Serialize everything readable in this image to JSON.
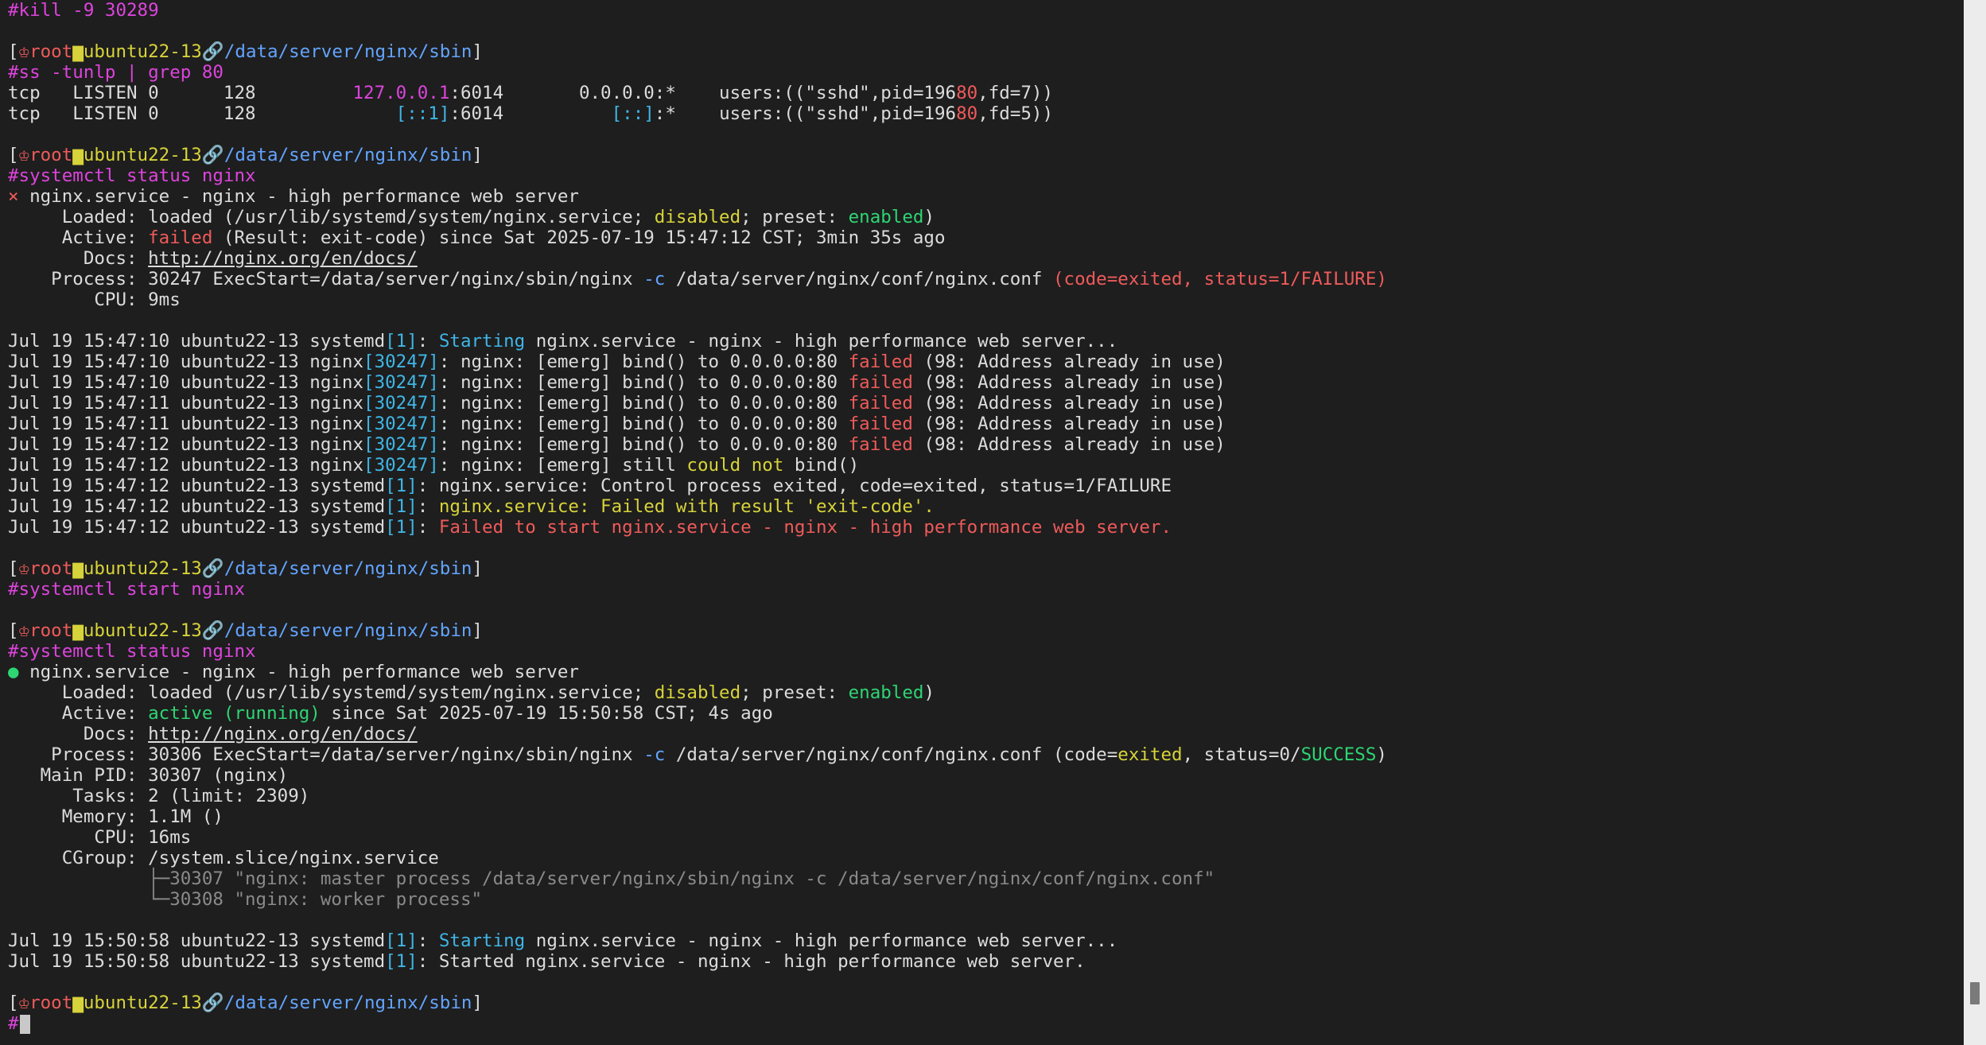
{
  "terminal": {
    "lines": [
      {
        "segs": [
          {
            "t": "#kill -9 30289",
            "c": "magenta"
          }
        ]
      },
      {
        "segs": []
      },
      {
        "segs": [
          {
            "t": "[",
            "c": "dim"
          },
          {
            "t": "♔",
            "c": "red"
          },
          {
            "t": "root",
            "c": "red"
          },
          {
            "t": "▆",
            "c": "yellow"
          },
          {
            "t": "ubuntu22-13",
            "c": "yellow"
          },
          {
            "t": "🔗",
            "c": "magenta"
          },
          {
            "t": "/data/server/nginx/sbin",
            "c": "blue"
          },
          {
            "t": "]",
            "c": "dim"
          }
        ]
      },
      {
        "segs": [
          {
            "t": "#ss -tunlp | grep 80",
            "c": "magenta"
          }
        ]
      },
      {
        "segs": [
          {
            "t": "tcp   LISTEN 0      128         ",
            "c": "dim"
          },
          {
            "t": "127.0.0.1",
            "c": "magenta"
          },
          {
            "t": ":6014       0.0.0.0:*    users:((\"sshd\",pid=196",
            "c": "dim"
          },
          {
            "t": "80",
            "c": "red"
          },
          {
            "t": ",fd=7))",
            "c": "dim"
          }
        ]
      },
      {
        "segs": [
          {
            "t": "tcp   LISTEN 0      128             ",
            "c": "dim"
          },
          {
            "t": "[::1]",
            "c": "cyan"
          },
          {
            "t": ":6014          ",
            "c": "dim"
          },
          {
            "t": "[::]",
            "c": "cyan"
          },
          {
            "t": ":*    users:((\"sshd\",pid=196",
            "c": "dim"
          },
          {
            "t": "80",
            "c": "red"
          },
          {
            "t": ",fd=5))",
            "c": "dim"
          }
        ]
      },
      {
        "segs": []
      },
      {
        "segs": [
          {
            "t": "[",
            "c": "dim"
          },
          {
            "t": "♔",
            "c": "red"
          },
          {
            "t": "root",
            "c": "red"
          },
          {
            "t": "▆",
            "c": "yellow"
          },
          {
            "t": "ubuntu22-13",
            "c": "yellow"
          },
          {
            "t": "🔗",
            "c": "magenta"
          },
          {
            "t": "/data/server/nginx/sbin",
            "c": "blue"
          },
          {
            "t": "]",
            "c": "dim"
          }
        ]
      },
      {
        "segs": [
          {
            "t": "#systemctl status nginx",
            "c": "magenta"
          }
        ]
      },
      {
        "segs": [
          {
            "t": "× ",
            "c": "red"
          },
          {
            "t": "nginx.service - nginx - high performance web server",
            "c": "dim"
          }
        ]
      },
      {
        "segs": [
          {
            "t": "     Loaded: loaded (/usr/lib/systemd/system/nginx.service; ",
            "c": "dim"
          },
          {
            "t": "disabled",
            "c": "yellow"
          },
          {
            "t": "; preset: ",
            "c": "dim"
          },
          {
            "t": "enabled",
            "c": "green"
          },
          {
            "t": ")",
            "c": "dim"
          }
        ]
      },
      {
        "segs": [
          {
            "t": "     Active: ",
            "c": "dim"
          },
          {
            "t": "failed",
            "c": "red"
          },
          {
            "t": " (Result: exit-code) since Sat 2025-07-19 15:47:12 CST; 3min 35s ago",
            "c": "dim"
          }
        ]
      },
      {
        "segs": [
          {
            "t": "       Docs: ",
            "c": "dim"
          },
          {
            "t": "http://nginx.org/en/docs/",
            "c": "dim",
            "u": true
          }
        ]
      },
      {
        "segs": [
          {
            "t": "    Process: 30247 ExecStart=/data/server/nginx/sbin/nginx ",
            "c": "dim"
          },
          {
            "t": "-c",
            "c": "blue"
          },
          {
            "t": " /data/server/nginx/conf/nginx.conf ",
            "c": "dim"
          },
          {
            "t": "(code=exited, status=1/FAILURE)",
            "c": "red"
          }
        ]
      },
      {
        "segs": [
          {
            "t": "        CPU: 9ms",
            "c": "dim"
          }
        ]
      },
      {
        "segs": []
      },
      {
        "segs": [
          {
            "t": "Jul 19 15:47:10 ubuntu22-13 systemd",
            "c": "dim"
          },
          {
            "t": "[1]",
            "c": "cyan"
          },
          {
            "t": ": ",
            "c": "dim"
          },
          {
            "t": "Starting",
            "c": "cyan"
          },
          {
            "t": " nginx.service - nginx - high performance web server...",
            "c": "dim"
          }
        ]
      },
      {
        "segs": [
          {
            "t": "Jul 19 15:47:10 ubuntu22-13 nginx",
            "c": "dim"
          },
          {
            "t": "[30247]",
            "c": "cyan"
          },
          {
            "t": ": nginx: [emerg] bind() to 0.0.0.0:80 ",
            "c": "dim"
          },
          {
            "t": "failed",
            "c": "red"
          },
          {
            "t": " (98: Address already in use)",
            "c": "dim"
          }
        ]
      },
      {
        "segs": [
          {
            "t": "Jul 19 15:47:10 ubuntu22-13 nginx",
            "c": "dim"
          },
          {
            "t": "[30247]",
            "c": "cyan"
          },
          {
            "t": ": nginx: [emerg] bind() to 0.0.0.0:80 ",
            "c": "dim"
          },
          {
            "t": "failed",
            "c": "red"
          },
          {
            "t": " (98: Address already in use)",
            "c": "dim"
          }
        ]
      },
      {
        "segs": [
          {
            "t": "Jul 19 15:47:11 ubuntu22-13 nginx",
            "c": "dim"
          },
          {
            "t": "[30247]",
            "c": "cyan"
          },
          {
            "t": ": nginx: [emerg] bind() to 0.0.0.0:80 ",
            "c": "dim"
          },
          {
            "t": "failed",
            "c": "red"
          },
          {
            "t": " (98: Address already in use)",
            "c": "dim"
          }
        ]
      },
      {
        "segs": [
          {
            "t": "Jul 19 15:47:11 ubuntu22-13 nginx",
            "c": "dim"
          },
          {
            "t": "[30247]",
            "c": "cyan"
          },
          {
            "t": ": nginx: [emerg] bind() to 0.0.0.0:80 ",
            "c": "dim"
          },
          {
            "t": "failed",
            "c": "red"
          },
          {
            "t": " (98: Address already in use)",
            "c": "dim"
          }
        ]
      },
      {
        "segs": [
          {
            "t": "Jul 19 15:47:12 ubuntu22-13 nginx",
            "c": "dim"
          },
          {
            "t": "[30247]",
            "c": "cyan"
          },
          {
            "t": ": nginx: [emerg] bind() to 0.0.0.0:80 ",
            "c": "dim"
          },
          {
            "t": "failed",
            "c": "red"
          },
          {
            "t": " (98: Address already in use)",
            "c": "dim"
          }
        ]
      },
      {
        "segs": [
          {
            "t": "Jul 19 15:47:12 ubuntu22-13 nginx",
            "c": "dim"
          },
          {
            "t": "[30247]",
            "c": "cyan"
          },
          {
            "t": ": nginx: [emerg] still ",
            "c": "dim"
          },
          {
            "t": "could not",
            "c": "yellow"
          },
          {
            "t": " bind()",
            "c": "dim"
          }
        ]
      },
      {
        "segs": [
          {
            "t": "Jul 19 15:47:12 ubuntu22-13 systemd",
            "c": "dim"
          },
          {
            "t": "[1]",
            "c": "cyan"
          },
          {
            "t": ": nginx.service: Control process exited, code=exited, status=1/FAILURE",
            "c": "dim"
          }
        ]
      },
      {
        "segs": [
          {
            "t": "Jul 19 15:47:12 ubuntu22-13 systemd",
            "c": "dim"
          },
          {
            "t": "[1]",
            "c": "cyan"
          },
          {
            "t": ": ",
            "c": "dim"
          },
          {
            "t": "nginx.service: Failed with result 'exit-code'.",
            "c": "yellow"
          }
        ]
      },
      {
        "segs": [
          {
            "t": "Jul 19 15:47:12 ubuntu22-13 systemd",
            "c": "dim"
          },
          {
            "t": "[1]",
            "c": "cyan"
          },
          {
            "t": ": ",
            "c": "dim"
          },
          {
            "t": "Failed to start nginx.service - nginx - high performance web server.",
            "c": "red"
          }
        ]
      },
      {
        "segs": []
      },
      {
        "segs": [
          {
            "t": "[",
            "c": "dim"
          },
          {
            "t": "♔",
            "c": "red"
          },
          {
            "t": "root",
            "c": "red"
          },
          {
            "t": "▆",
            "c": "yellow"
          },
          {
            "t": "ubuntu22-13",
            "c": "yellow"
          },
          {
            "t": "🔗",
            "c": "magenta"
          },
          {
            "t": "/data/server/nginx/sbin",
            "c": "blue"
          },
          {
            "t": "]",
            "c": "dim"
          }
        ]
      },
      {
        "segs": [
          {
            "t": "#systemctl start nginx",
            "c": "magenta"
          }
        ]
      },
      {
        "segs": []
      },
      {
        "segs": [
          {
            "t": "[",
            "c": "dim"
          },
          {
            "t": "♔",
            "c": "red"
          },
          {
            "t": "root",
            "c": "red"
          },
          {
            "t": "▆",
            "c": "yellow"
          },
          {
            "t": "ubuntu22-13",
            "c": "yellow"
          },
          {
            "t": "🔗",
            "c": "magenta"
          },
          {
            "t": "/data/server/nginx/sbin",
            "c": "blue"
          },
          {
            "t": "]",
            "c": "dim"
          }
        ]
      },
      {
        "segs": [
          {
            "t": "#systemctl status nginx",
            "c": "magenta"
          }
        ]
      },
      {
        "segs": [
          {
            "t": "● ",
            "c": "green"
          },
          {
            "t": "nginx.service - nginx - high performance web server",
            "c": "dim"
          }
        ]
      },
      {
        "segs": [
          {
            "t": "     Loaded: loaded (/usr/lib/systemd/system/nginx.service; ",
            "c": "dim"
          },
          {
            "t": "disabled",
            "c": "yellow"
          },
          {
            "t": "; preset: ",
            "c": "dim"
          },
          {
            "t": "enabled",
            "c": "green"
          },
          {
            "t": ")",
            "c": "dim"
          }
        ]
      },
      {
        "segs": [
          {
            "t": "     Active: ",
            "c": "dim"
          },
          {
            "t": "active (running)",
            "c": "green"
          },
          {
            "t": " since Sat 2025-07-19 15:50:58 CST; 4s ago",
            "c": "dim"
          }
        ]
      },
      {
        "segs": [
          {
            "t": "       Docs: ",
            "c": "dim"
          },
          {
            "t": "http://nginx.org/en/docs/",
            "c": "dim",
            "u": true
          }
        ]
      },
      {
        "segs": [
          {
            "t": "    Process: 30306 ExecStart=/data/server/nginx/sbin/nginx ",
            "c": "dim"
          },
          {
            "t": "-c",
            "c": "blue"
          },
          {
            "t": " /data/server/nginx/conf/nginx.conf (code=",
            "c": "dim"
          },
          {
            "t": "exited",
            "c": "yellow"
          },
          {
            "t": ", status=0/",
            "c": "dim"
          },
          {
            "t": "SUCCESS",
            "c": "green"
          },
          {
            "t": ")",
            "c": "dim"
          }
        ]
      },
      {
        "segs": [
          {
            "t": "   Main PID: 30307 (nginx)",
            "c": "dim"
          }
        ]
      },
      {
        "segs": [
          {
            "t": "      Tasks: 2 (limit: 2309)",
            "c": "dim"
          }
        ]
      },
      {
        "segs": [
          {
            "t": "     Memory: 1.1M ()",
            "c": "dim"
          }
        ]
      },
      {
        "segs": [
          {
            "t": "        CPU: 16ms",
            "c": "dim"
          }
        ]
      },
      {
        "segs": [
          {
            "t": "     CGroup: /system.slice/nginx.service",
            "c": "dim"
          }
        ]
      },
      {
        "segs": [
          {
            "t": "             ├─30307 \"nginx: master process /data/server/nginx/sbin/nginx -c /data/server/nginx/conf/nginx.conf\"",
            "c": "gray"
          }
        ]
      },
      {
        "segs": [
          {
            "t": "             └─30308 \"nginx: worker process\"",
            "c": "gray"
          }
        ]
      },
      {
        "segs": []
      },
      {
        "segs": [
          {
            "t": "Jul 19 15:50:58 ubuntu22-13 systemd",
            "c": "dim"
          },
          {
            "t": "[1]",
            "c": "cyan"
          },
          {
            "t": ": ",
            "c": "dim"
          },
          {
            "t": "Starting",
            "c": "cyan"
          },
          {
            "t": " nginx.service - nginx - high performance web server...",
            "c": "dim"
          }
        ]
      },
      {
        "segs": [
          {
            "t": "Jul 19 15:50:58 ubuntu22-13 systemd",
            "c": "dim"
          },
          {
            "t": "[1]",
            "c": "cyan"
          },
          {
            "t": ": Started nginx.service - nginx - high performance web server.",
            "c": "dim"
          }
        ]
      },
      {
        "segs": []
      },
      {
        "segs": [
          {
            "t": "[",
            "c": "dim"
          },
          {
            "t": "♔",
            "c": "red"
          },
          {
            "t": "root",
            "c": "red"
          },
          {
            "t": "▆",
            "c": "yellow"
          },
          {
            "t": "ubuntu22-13",
            "c": "yellow"
          },
          {
            "t": "🔗",
            "c": "magenta"
          },
          {
            "t": "/data/server/nginx/sbin",
            "c": "blue"
          },
          {
            "t": "]",
            "c": "dim"
          }
        ]
      },
      {
        "segs": [
          {
            "t": "#",
            "c": "magenta"
          }
        ],
        "cursor": true
      }
    ]
  },
  "scrollbar": {
    "position_fraction": 0.96
  },
  "colors": {
    "background": "#1e1e1e",
    "text": "#dcdcdc",
    "prompt_red": "#ef5a5a",
    "command_magenta": "#dd44dd",
    "ok_green": "#2ed573",
    "warn_yellow": "#d7d33a",
    "path_blue": "#63a4ff",
    "pid_cyan": "#3fb6e6"
  }
}
